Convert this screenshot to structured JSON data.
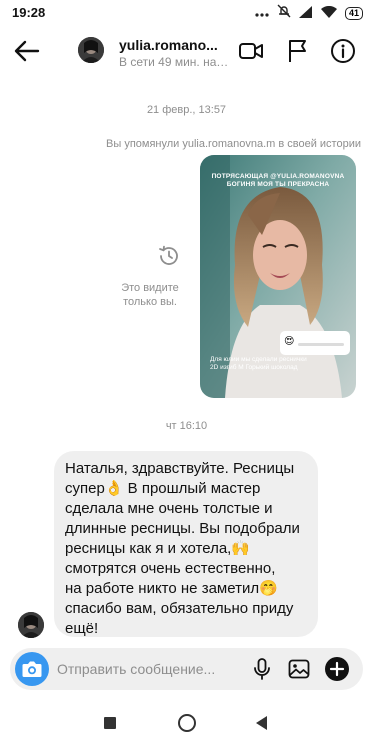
{
  "status_bar": {
    "time": "19:28",
    "battery": "41",
    "icons": [
      "notification-dots-icon",
      "mute-icon",
      "signal-icon",
      "wifi-icon",
      "battery-icon"
    ]
  },
  "header": {
    "username": "yulia.romano...",
    "status": "В сети 49 мин. наз...",
    "icons": [
      "back-arrow-icon",
      "video-call-icon",
      "flag-icon",
      "info-icon"
    ]
  },
  "chat": {
    "timestamp_1": "21 февр., 13:57",
    "mention_note": "Вы упомянули yulia.romanovna.m в своей истории",
    "story": {
      "top_caption": "ПОТРЯСАЮЩАЯ @YULIA.ROMANOVNA БОГИНЯ МОЯ ТЫ ПРЕКРАСНА",
      "slider_emoji": "😍",
      "bottom_caption": "Для юлии мы сделали реснички 2D изгиб М Горький шоколад"
    },
    "only_you_note": "Это видите только вы.",
    "timestamp_2": "чт 16:10",
    "message": {
      "lines": [
        "Наталья, здравствуйте. Ресницы",
        "супер👌 В прошлый мастер",
        "сделала мне очень толстые и",
        "длинные ресницы. Вы подобрали",
        "ресницы как я и хотела,🙌",
        "смотрятся очень естественно,",
        "на работе никто не заметил🤭",
        "спасибо вам, обязательно приду",
        "ещё!"
      ]
    }
  },
  "composer": {
    "placeholder": "Отправить сообщение...",
    "icons": [
      "camera-icon",
      "microphone-icon",
      "gallery-icon",
      "plus-circle-icon"
    ]
  },
  "colors": {
    "accent_blue": "#3797f0",
    "bubble_gray": "#efefef",
    "meta_gray": "#8e8e8e"
  }
}
